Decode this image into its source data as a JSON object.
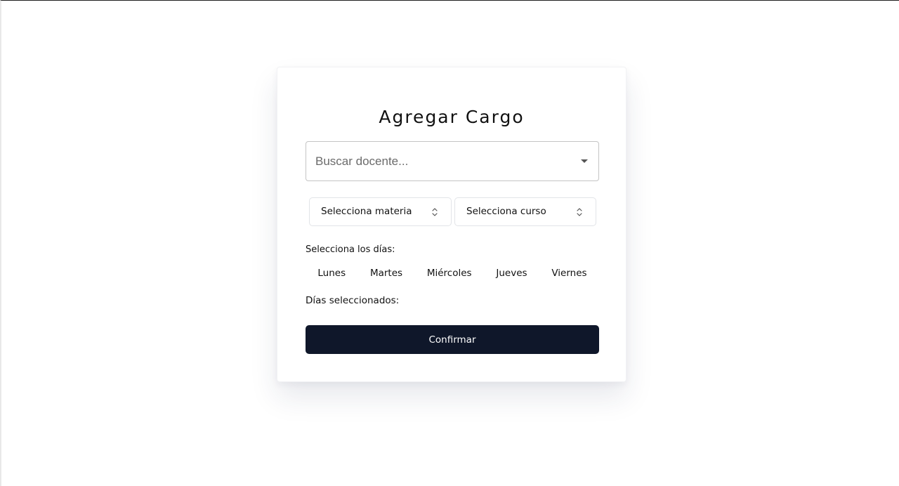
{
  "form": {
    "title": "Agregar Cargo",
    "docente_search": {
      "value": "",
      "placeholder": "Buscar docente..."
    },
    "materia_select": {
      "label": "Selecciona materia"
    },
    "curso_select": {
      "label": "Selecciona curso"
    },
    "days_label": "Selecciona los días:",
    "days": [
      {
        "label": "Lunes"
      },
      {
        "label": "Martes"
      },
      {
        "label": "Miércoles"
      },
      {
        "label": "Jueves"
      },
      {
        "label": "Viernes"
      }
    ],
    "selected_days_label": "Días seleccionados:",
    "confirm_label": "Confirmar"
  },
  "icons": {
    "docente_dropdown": "caret-down-icon",
    "select_chevrons": "chevron-up-down-icon"
  },
  "colors": {
    "primary_button": "#0f172a",
    "primary_button_text": "#ffffff",
    "input_border": "#c4c4c4",
    "select_border": "#e2e4e8"
  }
}
